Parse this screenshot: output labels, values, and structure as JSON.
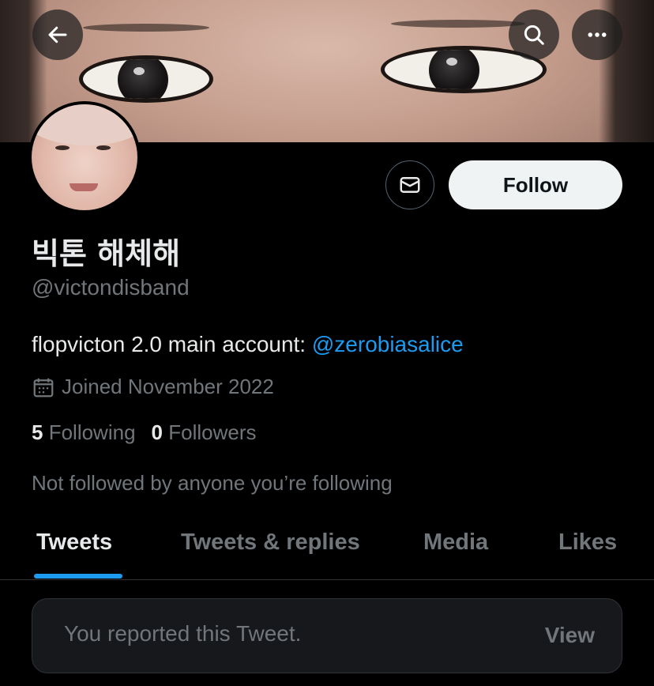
{
  "profile": {
    "display_name": "빅톤 해체해",
    "handle": "@victondisband",
    "bio_text": "flopvicton 2.0 main account: ",
    "bio_mention": "@zerobiasalice",
    "joined": "Joined November 2022",
    "following_count": "5",
    "following_label": "Following",
    "followers_count": "0",
    "followers_label": "Followers",
    "not_followed_note": "Not followed by anyone you’re following"
  },
  "actions": {
    "follow_label": "Follow"
  },
  "tabs": [
    {
      "label": "Tweets",
      "active": true
    },
    {
      "label": "Tweets & replies",
      "active": false
    },
    {
      "label": "Media",
      "active": false
    },
    {
      "label": "Likes",
      "active": false
    }
  ],
  "notice": {
    "text": "You reported this Tweet.",
    "view_label": "View"
  },
  "icons": {
    "back": "arrow-left-icon",
    "search": "search-icon",
    "more": "more-horizontal-icon",
    "message": "mail-icon",
    "calendar": "calendar-icon"
  },
  "colors": {
    "accent": "#1d9bf0",
    "background": "#000000",
    "muted_text": "#71767b",
    "primary_text": "#e7e9ea"
  }
}
